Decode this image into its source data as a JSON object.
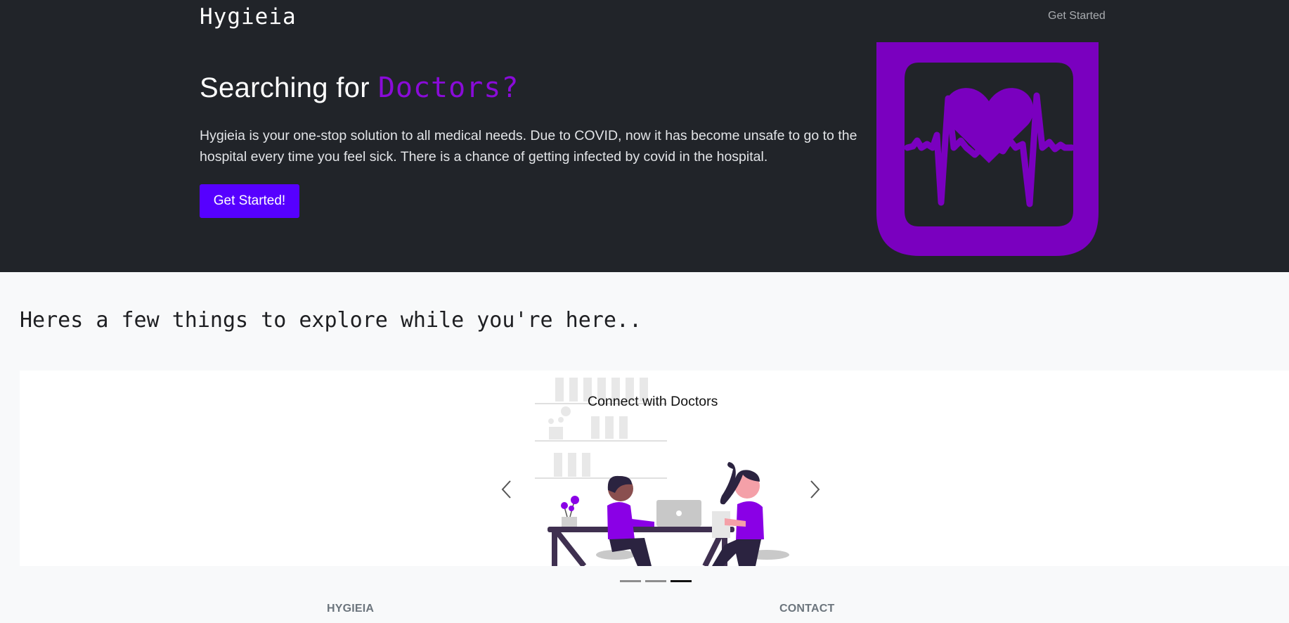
{
  "header": {
    "brand": "Hygieia",
    "nav_link": "Get Started"
  },
  "hero": {
    "title_prefix": "Searching for",
    "title_accent": "Doctors?",
    "description": "Hygieia is your one-stop solution to all medical needs. Due to COVID, now it has become unsafe to go to the hospital every time you feel sick. There is a chance of getting infected by covid in the hospital.",
    "cta_label": "Get Started!",
    "graphic_icon": "heart-pulse-monitor-icon"
  },
  "explore": {
    "heading": "Heres a few things to explore while you're here.."
  },
  "carousel": {
    "active_index": 2,
    "slide_count": 3,
    "caption": "Connect with Doctors",
    "illustration_icon": "doctors-at-desk-illustration",
    "prev_icon": "chevron-left-icon",
    "next_icon": "chevron-right-icon"
  },
  "footer": {
    "col1_title": "HYGIEIA",
    "col2_title": "CONTACT"
  },
  "colors": {
    "hero_bg": "#212429",
    "accent_purple": "#8a0bd9",
    "button_blue": "#5600ff",
    "page_bg": "#f8f9fa"
  }
}
